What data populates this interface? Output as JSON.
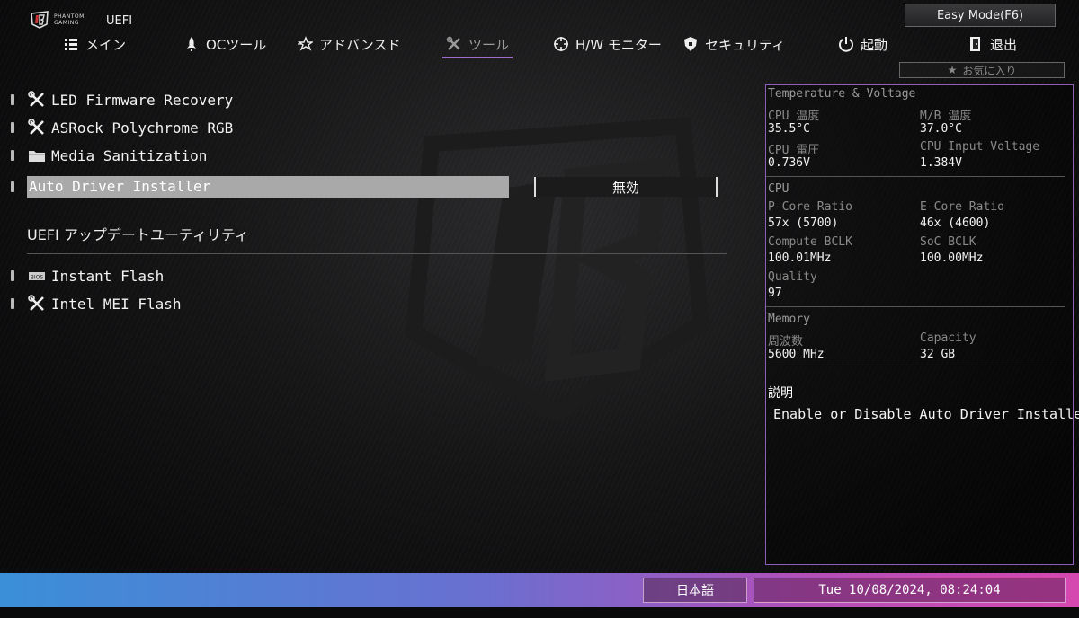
{
  "header": {
    "brand_line1": "PHANTOM",
    "brand_line2": "GAMING",
    "uefi_label": "UEFI",
    "easy_mode": "Easy Mode(F6)",
    "favorites": "お気に入り"
  },
  "nav": [
    {
      "label": "メイン",
      "icon": "list-icon"
    },
    {
      "label": "OCツール",
      "icon": "rocket-icon"
    },
    {
      "label": "アドバンスド",
      "icon": "star-icon"
    },
    {
      "label": "ツール",
      "icon": "tools-icon",
      "active": true
    },
    {
      "label": "H/W モニター",
      "icon": "crosshair-icon"
    },
    {
      "label": "セキュリティ",
      "icon": "shield-icon"
    },
    {
      "label": "起動",
      "icon": "power-icon"
    },
    {
      "label": "退出",
      "icon": "exit-icon"
    }
  ],
  "menu": {
    "items": [
      {
        "label": "LED Firmware Recovery",
        "icon": "tools-icon"
      },
      {
        "label": "ASRock Polychrome RGB",
        "icon": "tools-icon"
      },
      {
        "label": "Media Sanitization",
        "icon": "folder-icon"
      }
    ],
    "selected": {
      "label": "Auto Driver Installer",
      "value": "無効"
    },
    "section_title": "UEFI アップデートユーティリティ",
    "update_items": [
      {
        "label": "Instant Flash",
        "icon": "bios-icon"
      },
      {
        "label": "Intel MEI Flash",
        "icon": "tools-icon"
      }
    ]
  },
  "monitor": {
    "tv_title": "Temperature & Voltage",
    "cpu_temp_label": "CPU 温度",
    "cpu_temp": "35.5°C",
    "mb_temp_label": "M/B 温度",
    "mb_temp": "37.0°C",
    "cpu_volt_label": "CPU 電圧",
    "cpu_volt": "0.736V",
    "cpu_input_label": "CPU Input Voltage",
    "cpu_input": "1.384V",
    "cpu_title": "CPU",
    "pcore_label": "P-Core Ratio",
    "pcore": "57x (5700)",
    "ecore_label": "E-Core Ratio",
    "ecore": "46x (4600)",
    "compute_label": "Compute BCLK",
    "compute": "100.01MHz",
    "soc_label": "SoC BCLK",
    "soc": "100.00MHz",
    "quality_label": "Quality",
    "quality": "97",
    "mem_title": "Memory",
    "freq_label": "周波数",
    "freq": "5600 MHz",
    "cap_label": "Capacity",
    "cap": "32 GB"
  },
  "description": {
    "title": "説明",
    "text": "Enable or Disable Auto Driver Installer"
  },
  "footer": {
    "language": "日本語",
    "datetime": "Tue 10/08/2024, 08:24:04"
  }
}
